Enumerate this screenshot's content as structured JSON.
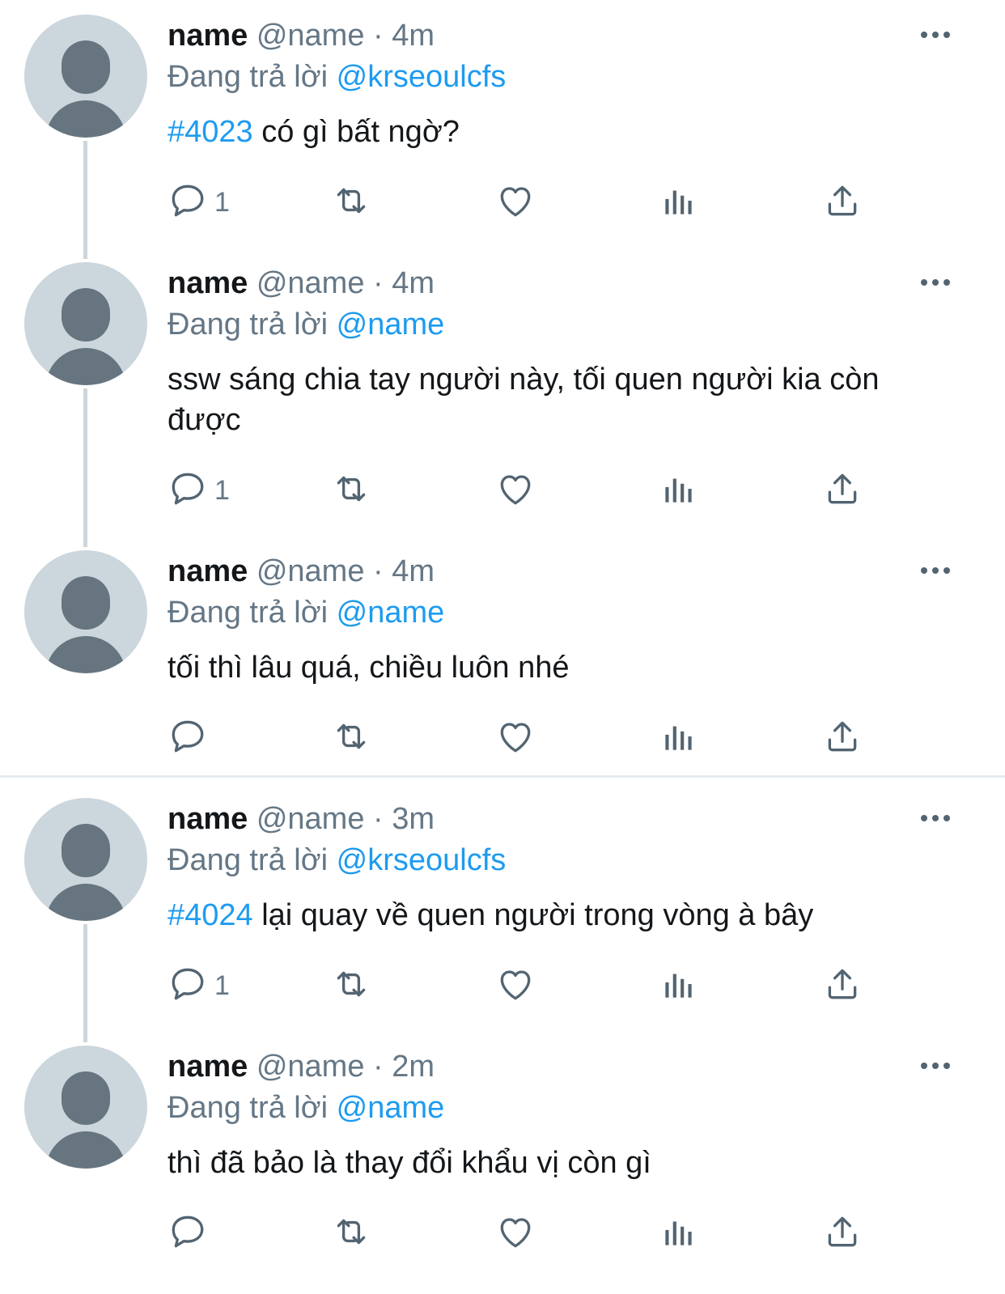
{
  "tweets": [
    {
      "name": "name",
      "handle": "@name",
      "separator": "·",
      "time": "4m",
      "reply_prefix": "Đang trả lời",
      "reply_to": "@krseoulcfs",
      "hashtag": "#4023",
      "text": " có gì bất ngờ?",
      "reply_count": "1"
    },
    {
      "name": "name",
      "handle": "@name",
      "separator": "·",
      "time": "4m",
      "reply_prefix": "Đang trả lời",
      "reply_to": "@name",
      "hashtag": "",
      "text": "ssw sáng chia tay người này, tối quen người kia còn được",
      "reply_count": "1"
    },
    {
      "name": "name",
      "handle": "@name",
      "separator": "·",
      "time": "4m",
      "reply_prefix": "Đang trả lời",
      "reply_to": "@name",
      "hashtag": "",
      "text": "tối thì lâu quá, chiều luôn nhé",
      "reply_count": ""
    },
    {
      "name": "name",
      "handle": "@name",
      "separator": "·",
      "time": "3m",
      "reply_prefix": "Đang trả lời",
      "reply_to": "@krseoulcfs",
      "hashtag": "#4024",
      "text": " lại quay về quen người trong vòng à bây",
      "reply_count": "1"
    },
    {
      "name": "name",
      "handle": "@name",
      "separator": "·",
      "time": "2m",
      "reply_prefix": "Đang trả lời",
      "reply_to": "@name",
      "hashtag": "",
      "text": "thì đã bảo là thay đổi khẩu vị còn gì",
      "reply_count": ""
    }
  ],
  "icons": {
    "reply": "reply-icon",
    "retweet": "retweet-icon",
    "like": "heart-icon",
    "views": "views-icon",
    "share": "share-icon",
    "more": "more-icon",
    "avatar": "default-avatar-icon"
  },
  "colors": {
    "accent": "#1d9bf0",
    "muted": "#657786",
    "text": "#14171a",
    "avatar_bg": "#ccd6dd",
    "avatar_fg": "#66757f"
  }
}
